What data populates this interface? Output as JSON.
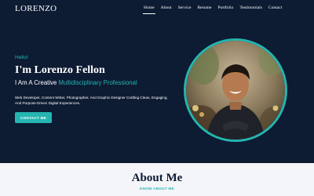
{
  "header": {
    "logo": "LORENZO",
    "nav": [
      "Home",
      "About",
      "Service",
      "Resume",
      "Portfolio",
      "Testimonials",
      "Contact"
    ],
    "active_index": 0
  },
  "hero": {
    "greeting": "Hello!",
    "name": "I'm Lorenzo Fellon",
    "role_prefix": "I Am A Creative",
    "role_highlight": "Multidisciplinary Professional",
    "description": "Web Developer, Content Writer, Photographer, And Graphic Designer Crafting Clean, Engaging, And Purpose-Driven Digital Experiences.",
    "cta_label": "CONTACT ME",
    "portrait_icon": "profile-photo"
  },
  "about": {
    "title": "About Me",
    "subtitle": "KNOW ABOUT ME"
  },
  "colors": {
    "background": "#0d1b33",
    "accent": "#25b5b0",
    "section_light": "#f4f5f9"
  }
}
